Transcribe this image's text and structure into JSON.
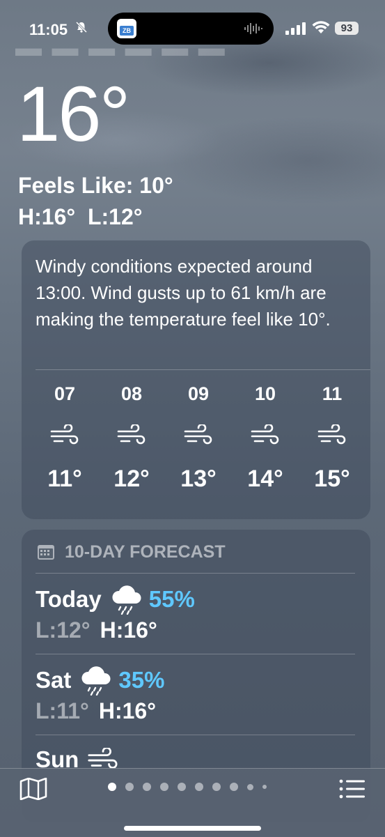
{
  "status_bar": {
    "time": "11:05",
    "battery": "93",
    "live_activity_app": "ZB",
    "icons": [
      "bell-slash-icon",
      "waveform-icon",
      "cellular-signal-icon",
      "wifi-icon",
      "battery-icon"
    ]
  },
  "current": {
    "temperature": "16°",
    "feels_like": "Feels Like: 10°",
    "high_low": "H:16°  L:12°"
  },
  "summary_card": {
    "text": "Windy conditions expected around 13:00. Wind gusts up to 61 km/h are making the temperature feel like 10°.",
    "hourly": [
      {
        "hour": "07",
        "icon": "wind-icon",
        "temp": "11°"
      },
      {
        "hour": "08",
        "icon": "wind-icon",
        "temp": "12°"
      },
      {
        "hour": "09",
        "icon": "wind-icon",
        "temp": "13°"
      },
      {
        "hour": "10",
        "icon": "wind-icon",
        "temp": "14°"
      },
      {
        "hour": "11",
        "icon": "wind-icon",
        "temp": "15°"
      }
    ]
  },
  "forecast_card": {
    "header": "10-DAY FORECAST",
    "header_icon": "calendar-icon",
    "days": [
      {
        "day": "Today",
        "icon": "cloud-rain-icon",
        "precip": "55%",
        "low": "L:12°",
        "high": "H:16°"
      },
      {
        "day": "Sat",
        "icon": "cloud-rain-icon",
        "precip": "35%",
        "low": "L:11°",
        "high": "H:16°"
      },
      {
        "day": "Sun",
        "icon": "wind-icon",
        "precip": "",
        "low": "",
        "high": ""
      }
    ]
  },
  "bottom_bar": {
    "page_dots": 10,
    "active_page": 0,
    "icons": [
      "map-icon",
      "list-icon"
    ]
  },
  "colors": {
    "precip_blue": "#5fc8ff",
    "card_bg": "rgba(60,72,88,0.45)"
  }
}
